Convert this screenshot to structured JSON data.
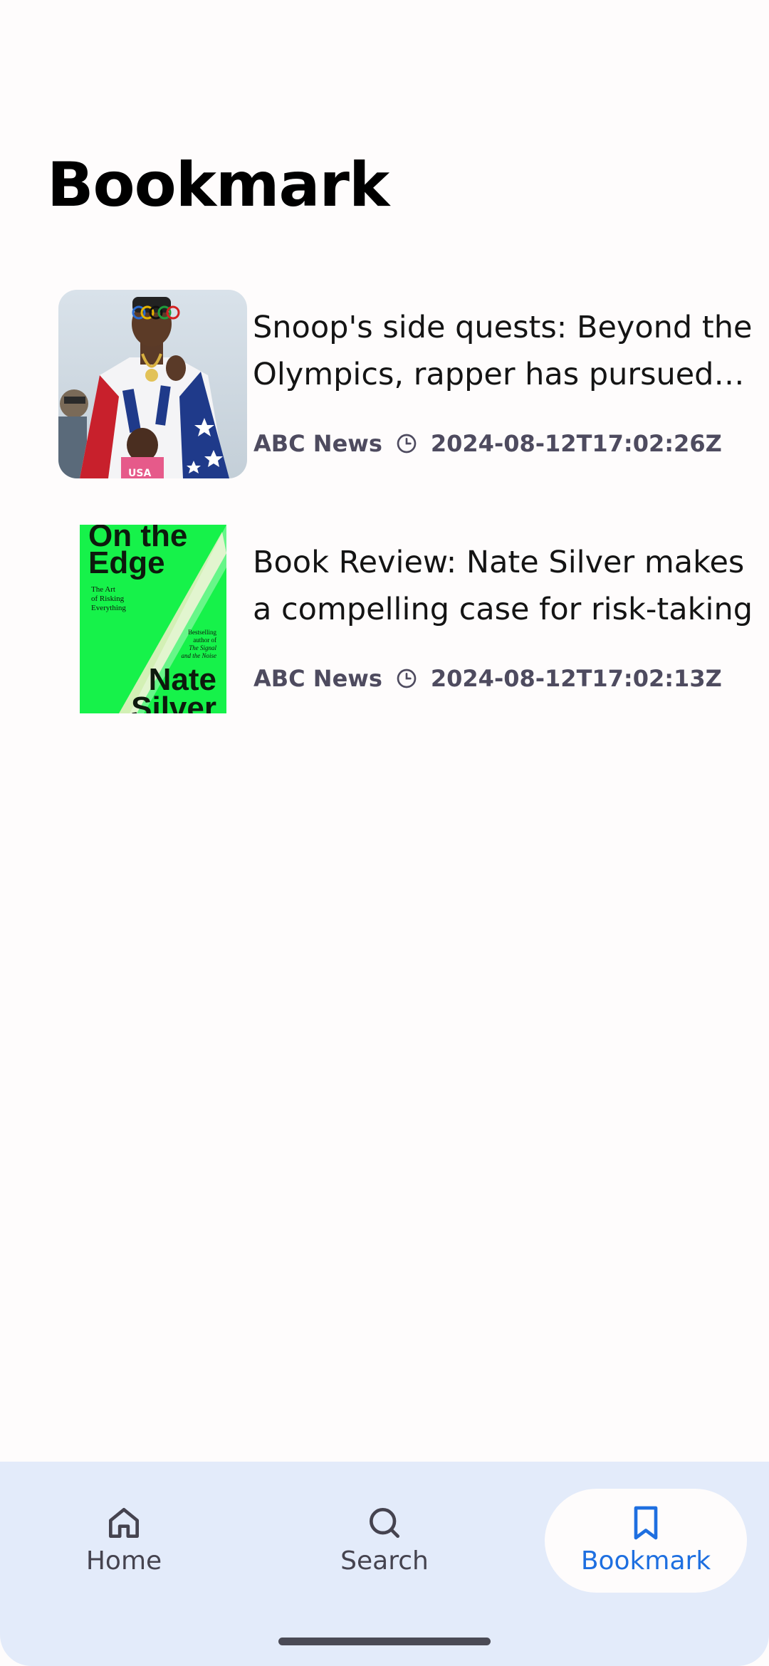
{
  "page": {
    "title": "Bookmark"
  },
  "articles": [
    {
      "headline": "Snoop's side quests: Beyond the Olympics, rapper has pursued the spotlight",
      "source": "ABC News",
      "published": "2024-08-12T17:02:26Z",
      "thumbnail_icon": "photo-thumbnail"
    },
    {
      "headline": "Book Review: Nate Silver makes a compelling case for risk-taking",
      "source": "ABC News",
      "published": "2024-08-12T17:02:13Z",
      "thumbnail_icon": "book-cover-thumbnail",
      "cover": {
        "title_line1": "On the",
        "title_line2": "Edge",
        "subtitle_1": "The Art",
        "subtitle_2": "of Risking",
        "subtitle_3": "Everything",
        "blurb_1": "Bestselling",
        "blurb_2": "author of",
        "blurb_3": "The Signal",
        "blurb_4": "and the Noise",
        "author_1": "Nate",
        "author_2": "Silver"
      }
    }
  ],
  "nav": {
    "items": [
      {
        "label": "Home",
        "icon": "home-icon",
        "selected": false
      },
      {
        "label": "Search",
        "icon": "search-icon",
        "selected": false
      },
      {
        "label": "Bookmark",
        "icon": "bookmark-icon",
        "selected": true
      }
    ]
  },
  "colors": {
    "background": "#fefcfc",
    "nav_background": "#e3ebfa",
    "accent": "#1e6fe0",
    "meta_text": "#4e4b5f",
    "cover_green": "#16f24a"
  }
}
